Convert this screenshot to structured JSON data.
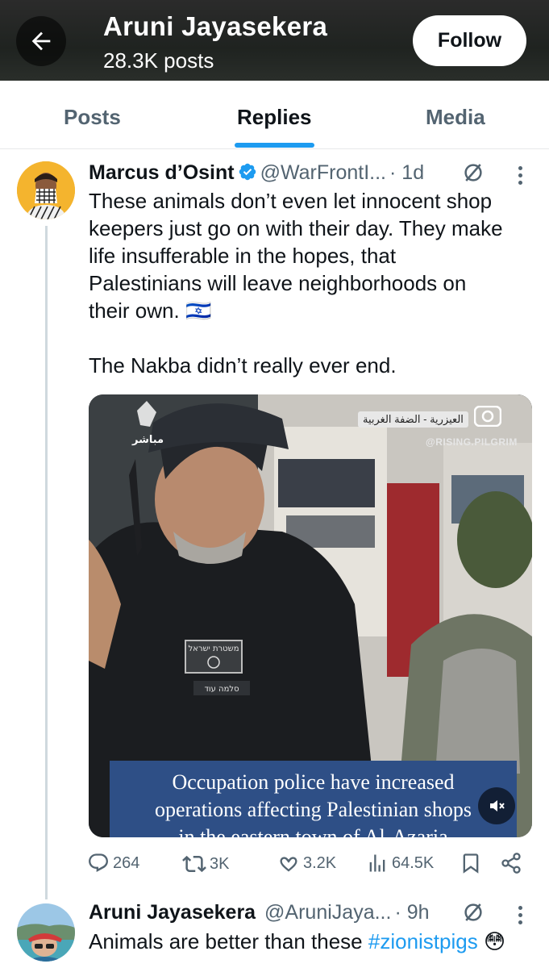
{
  "header": {
    "name": "Aruni Jayasekera",
    "posts_count": "28.3K posts",
    "follow_label": "Follow"
  },
  "tabs": [
    {
      "label": "Posts"
    },
    {
      "label": "Replies"
    },
    {
      "label": "Media"
    }
  ],
  "post1": {
    "display_name": "Marcus d’Osint",
    "handle": "@WarFrontI...",
    "time": "· 1d",
    "text_lines": [
      "These animals don’t even let innocent shop",
      "keepers just go on with their day. They make",
      "life insufferable in the hopes, that",
      "Palestinians will leave neighborhoods on",
      "their own."
    ],
    "text_line2": "The Nakba didn’t really ever end.",
    "flag_emoji": "🇮🇱",
    "media": {
      "caption_line1": "Occupation police have increased",
      "caption_line2": "operations affecting Palestinian shops",
      "caption_line3": "in the eastern town of Al-Azaria",
      "watermark": "@RISING.PILGRIM",
      "arabic_label": "العيزرية - الضفة الغربية",
      "channel_mark": "مباشر"
    },
    "stats": {
      "replies": "264",
      "reposts": "3K",
      "likes": "3.2K",
      "views": "64.5K"
    }
  },
  "post2": {
    "display_name": "Aruni Jayasekera",
    "handle": "@AruniJaya...",
    "time": "· 9h",
    "text": "Animals are better than these ",
    "hashtag": "#zionistpigs",
    "emoji": "😳"
  },
  "colors": {
    "accent": "#1d9bf0",
    "verified": "#1d9bf0",
    "secondary_text": "#536471"
  }
}
